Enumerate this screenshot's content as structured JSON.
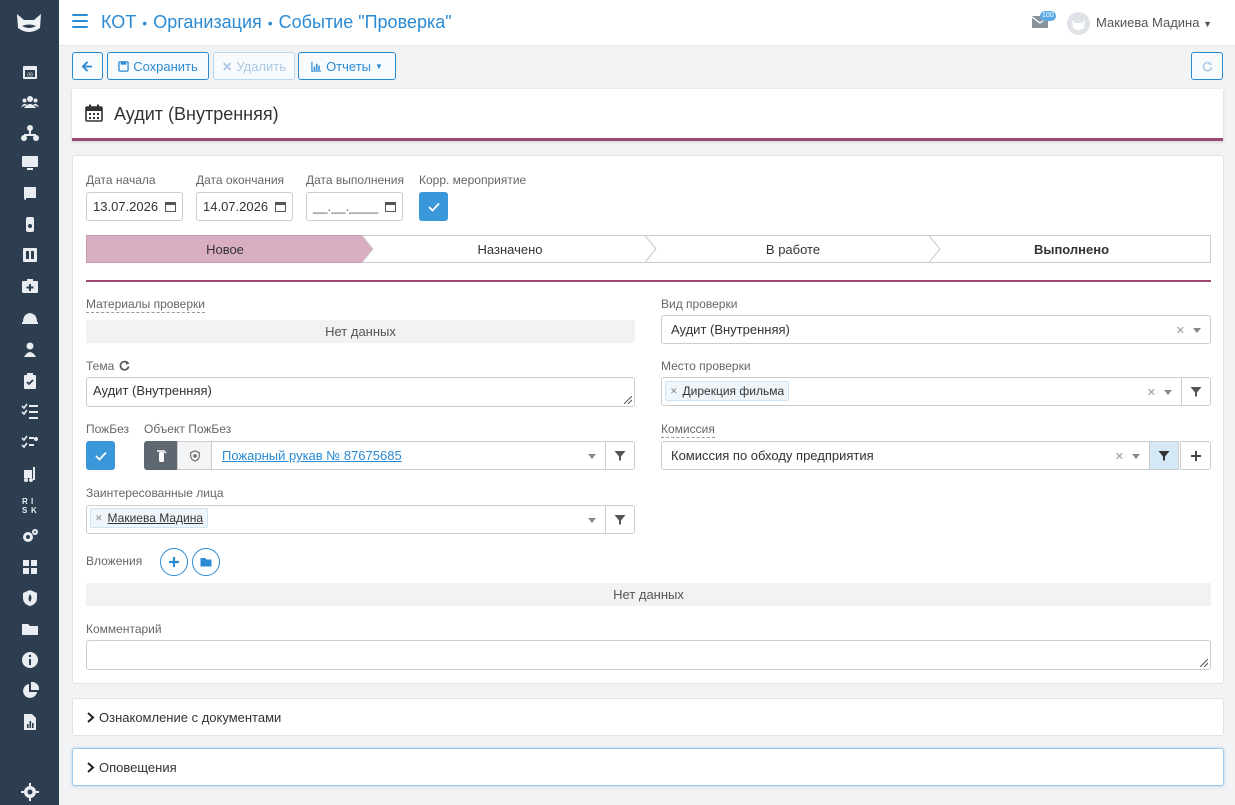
{
  "header": {
    "crumbs": [
      "КОТ",
      "Организация",
      "Событие \"Проверка\""
    ],
    "mail_badge": "100",
    "user_name": "Макиева Мадина"
  },
  "toolbar": {
    "save_label": "Сохранить",
    "delete_label": "Удалить",
    "reports_label": "Отчеты"
  },
  "title": "Аудит (Внутренняя)",
  "form": {
    "start_date_label": "Дата начала",
    "start_date": "13.07.2026",
    "end_date_label": "Дата окончания",
    "end_date": "14.07.2026",
    "done_date_label": "Дата выполнения",
    "done_date_placeholder": "__.__.____",
    "corp_label": "Корр. мероприятие",
    "steps": [
      "Новое",
      "Назначено",
      "В работе",
      "Выполнено"
    ],
    "materials_label": "Материалы проверки",
    "no_data": "Нет данных",
    "topic_label": "Тема",
    "topic_value": "Аудит (Внутренняя)",
    "fire_label": "ПожБез",
    "fire_object_label": "Объект ПожБез",
    "fire_object_value": "Пожарный рукав № 87675685",
    "interested_label": "Заинтересованные лица",
    "interested_tag": "Макиева Мадина",
    "audit_type_label": "Вид проверки",
    "audit_type_value": "Аудит (Внутренняя)",
    "place_label": "Место проверки",
    "place_tag": "Дирекция фильма",
    "commission_label": "Комиссия",
    "commission_value": "Комиссия по обходу предприятия",
    "attachments_label": "Вложения",
    "attachments_no_data": "Нет данных",
    "comment_label": "Комментарий"
  },
  "sections": {
    "docs": "Ознакомление с документами",
    "notifications": "Оповещения"
  },
  "colors": {
    "accent": "#2a8ad4",
    "sidebar": "#2c3e50",
    "step_active": "#d9aec2",
    "divider": "#9b4a73",
    "check": "#3a97d9"
  }
}
